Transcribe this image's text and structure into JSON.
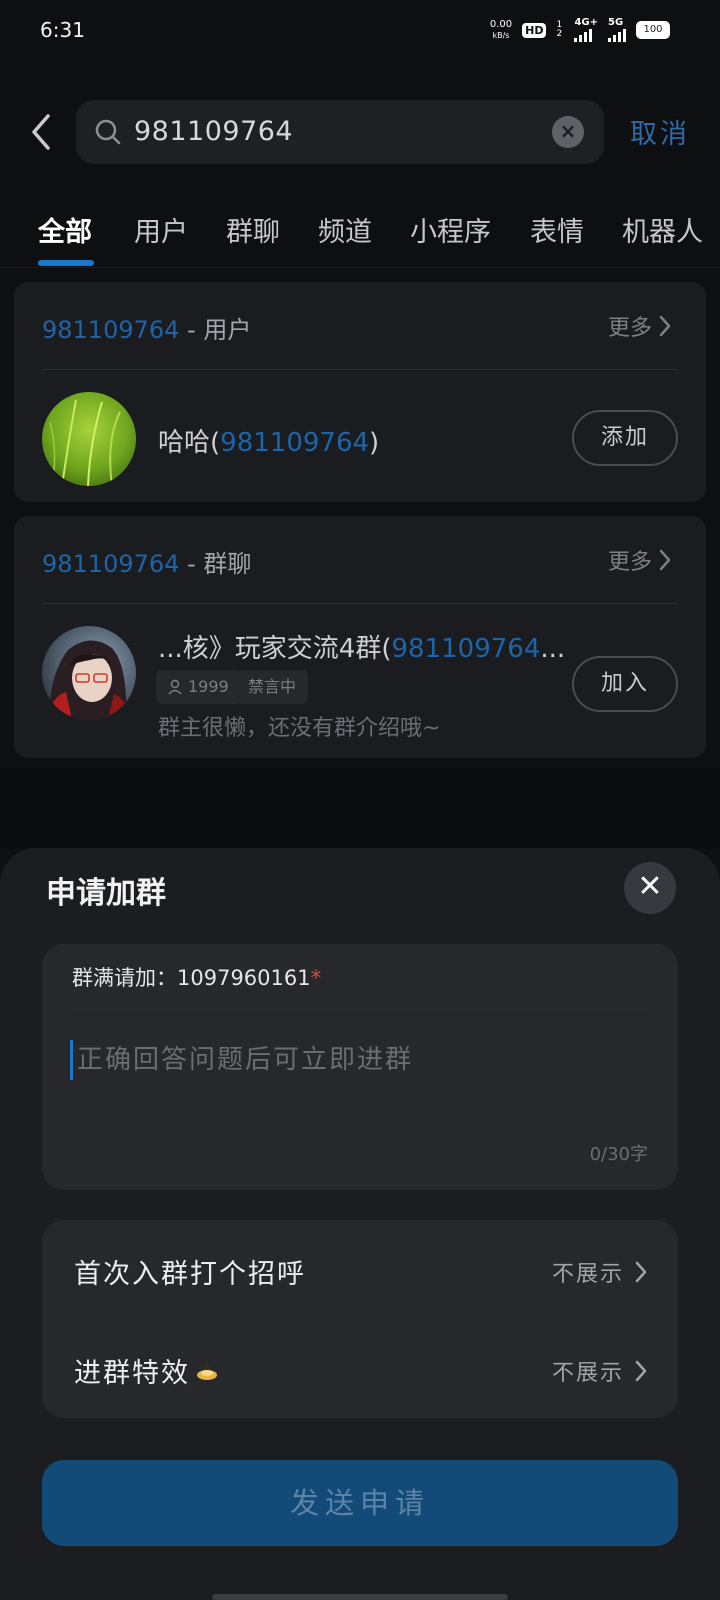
{
  "status_bar": {
    "time": "6:31",
    "net_speed": "0.00",
    "net_unit": "kB/s",
    "hd_badge": "HD",
    "sim_indicator": "1 2",
    "net_4g": "4G+",
    "net_5g": "5G",
    "battery": "100"
  },
  "search": {
    "query": "981109764",
    "cancel_label": "取消"
  },
  "tabs": [
    "全部",
    "用户",
    "群聊",
    "频道",
    "小程序",
    "表情",
    "机器人"
  ],
  "users_section": {
    "title_id": "981109764",
    "title_suffix": " - 用户",
    "more_label": "更多",
    "result": {
      "name_prefix": "哈哈(",
      "name_id": "981109764",
      "name_suffix": ")",
      "action_label": "添加"
    }
  },
  "groups_section": {
    "title_id": "981109764",
    "title_suffix": " - 群聊",
    "more_label": "更多",
    "result": {
      "name_prefix": "...核》玩家交流4群(",
      "name_id": "981109764",
      "name_suffix": "...",
      "member_count": "1999",
      "status_tag": "禁言中",
      "description": "群主很懒，还没有群介绍哦~",
      "action_label": "加入"
    }
  },
  "join_sheet": {
    "title": "申请加群",
    "question_label": "群满请加：",
    "question_value": "1097960161",
    "required_mark": "*",
    "answer_placeholder": "正确回答问题后可立即进群",
    "char_count": "0/30字",
    "greeting_label": "首次入群打个招呼",
    "greeting_value": "不展示",
    "effect_label": "进群特效",
    "effect_value": "不展示",
    "submit_label": "发送申请"
  },
  "colors": {
    "accent": "#1d77c9",
    "link_blue": "#1d64a8",
    "submit_bg": "#124a78",
    "required": "#e04a3a"
  }
}
